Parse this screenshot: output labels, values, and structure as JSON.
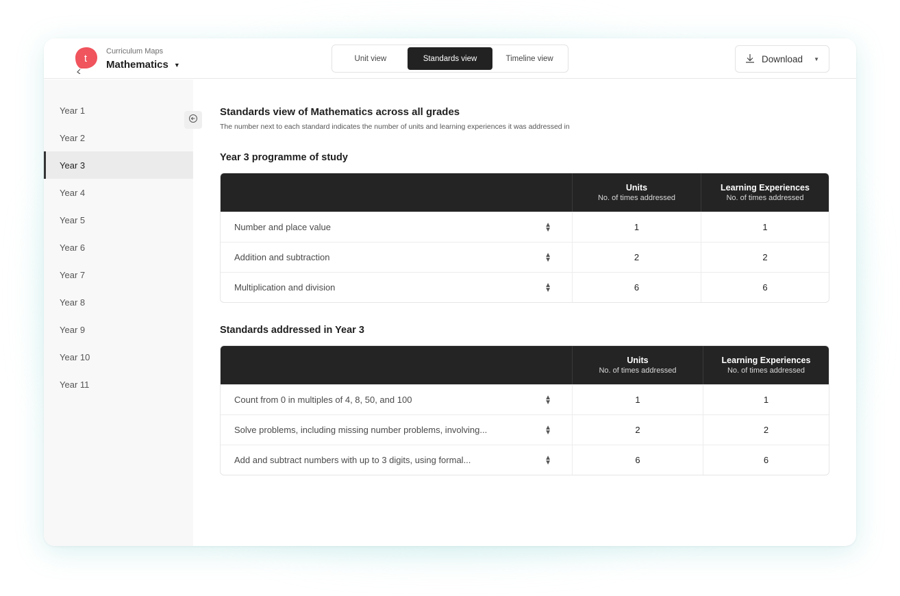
{
  "header": {
    "subtitle": "Curriculum Maps",
    "title": "Mathematics",
    "logo_letter": "t",
    "views": [
      {
        "label": "Unit view",
        "active": false
      },
      {
        "label": "Standards view",
        "active": true
      },
      {
        "label": "Timeline view",
        "active": false
      }
    ],
    "download_label": "Download"
  },
  "sidebar": {
    "items": [
      {
        "label": "Year 1",
        "active": false
      },
      {
        "label": "Year 2",
        "active": false
      },
      {
        "label": "Year 3",
        "active": true
      },
      {
        "label": "Year 4",
        "active": false
      },
      {
        "label": "Year 5",
        "active": false
      },
      {
        "label": "Year 6",
        "active": false
      },
      {
        "label": "Year 7",
        "active": false
      },
      {
        "label": "Year 8",
        "active": false
      },
      {
        "label": "Year 9",
        "active": false
      },
      {
        "label": "Year 10",
        "active": false
      },
      {
        "label": "Year 11",
        "active": false
      }
    ]
  },
  "main": {
    "title": "Standards view of Mathematics across all grades",
    "subtitle": "The number next to each standard indicates the number of units and learning experiences it was addressed in",
    "tables": [
      {
        "title": "Year 3 programme of study",
        "columns": [
          {
            "title": "Units",
            "sub": "No. of times addressed"
          },
          {
            "title": "Learning Experiences",
            "sub": "No. of times addressed"
          }
        ],
        "rows": [
          {
            "label": "Number and place value",
            "units": "1",
            "experiences": "1"
          },
          {
            "label": "Addition and subtraction",
            "units": "2",
            "experiences": "2"
          },
          {
            "label": "Multiplication and division",
            "units": "6",
            "experiences": "6"
          }
        ]
      },
      {
        "title": "Standards addressed in Year 3",
        "columns": [
          {
            "title": "Units",
            "sub": "No. of times addressed"
          },
          {
            "title": "Learning Experiences",
            "sub": "No. of times addressed"
          }
        ],
        "rows": [
          {
            "label": "Count from 0 in multiples of 4, 8, 50, and 100",
            "units": "1",
            "experiences": "1"
          },
          {
            "label": "Solve problems, including missing number problems, involving...",
            "units": "2",
            "experiences": "2"
          },
          {
            "label": "Add and subtract numbers with up to 3 digits, using formal...",
            "units": "6",
            "experiences": "6"
          }
        ]
      }
    ]
  },
  "colors": {
    "accent": "#f0545d",
    "dark": "#242424",
    "sidebar_bg": "#f8f8f8"
  }
}
